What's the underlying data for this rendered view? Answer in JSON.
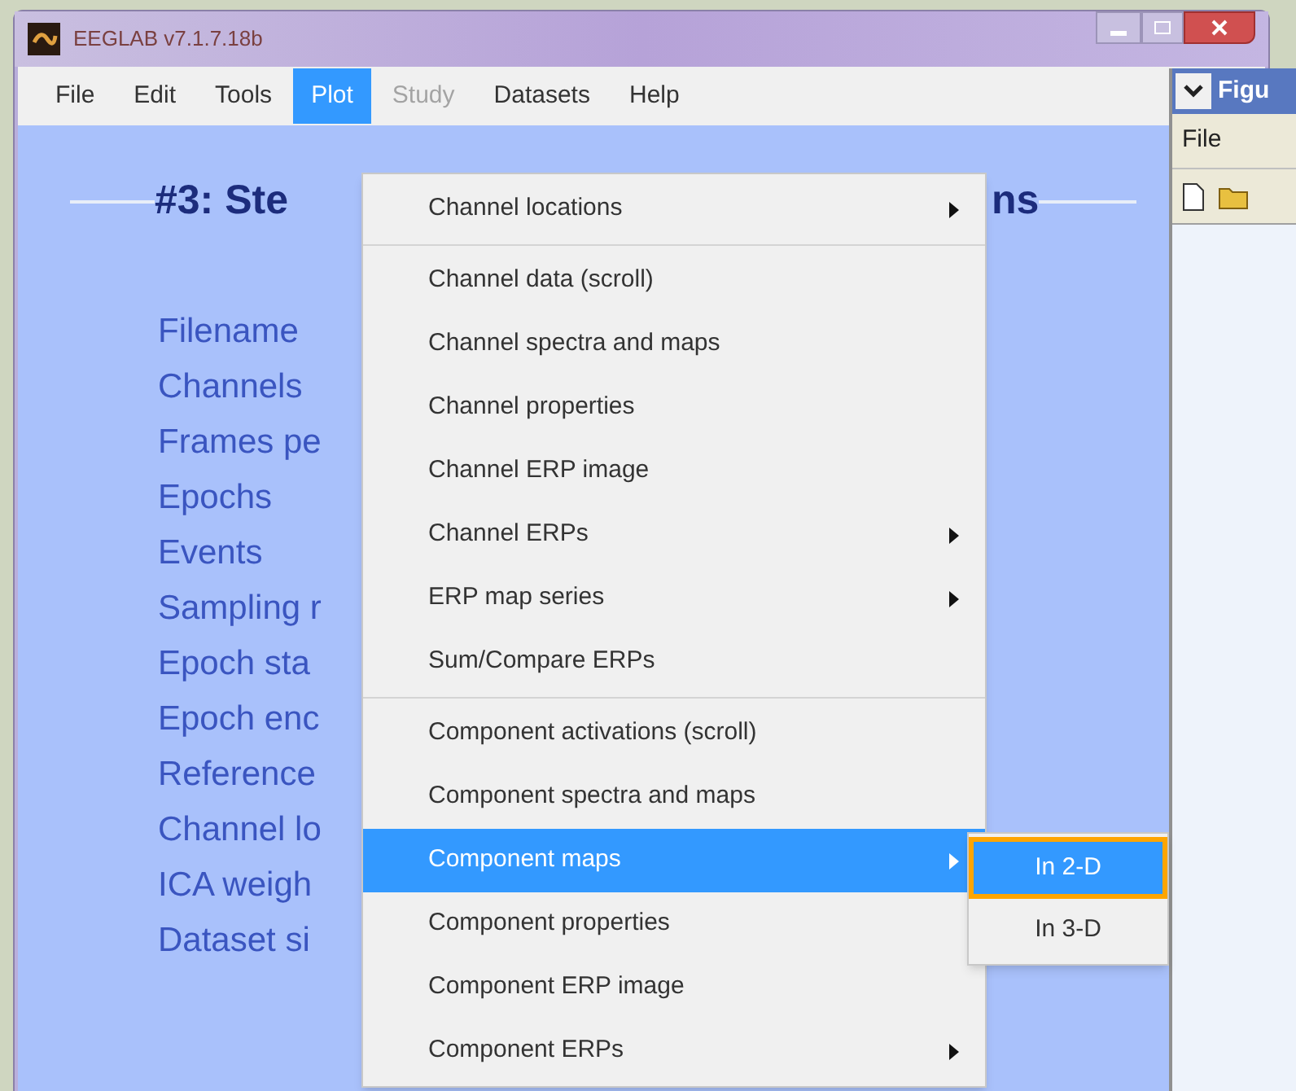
{
  "main_window": {
    "title": "EEGLAB v7.1.7.18b",
    "menu_bar": [
      {
        "label": "File",
        "selected": false,
        "disabled": false
      },
      {
        "label": "Edit",
        "selected": false,
        "disabled": false
      },
      {
        "label": "Tools",
        "selected": false,
        "disabled": false
      },
      {
        "label": "Plot",
        "selected": true,
        "disabled": false
      },
      {
        "label": "Study",
        "selected": false,
        "disabled": true
      },
      {
        "label": "Datasets",
        "selected": false,
        "disabled": false
      },
      {
        "label": "Help",
        "selected": false,
        "disabled": false
      }
    ],
    "heading_left": "#3: Ste",
    "heading_right": "ns",
    "fields": [
      "Filename",
      "Channels",
      "Frames pe",
      "Epochs",
      "Events",
      "Sampling r",
      "Epoch sta",
      "Epoch enc",
      "Reference",
      "Channel lo",
      "ICA weigh",
      "Dataset si"
    ]
  },
  "plot_menu": {
    "groups": [
      [
        {
          "label": "Channel locations",
          "submenu": true,
          "selected": false
        }
      ],
      [
        {
          "label": "Channel data (scroll)",
          "submenu": false,
          "selected": false
        },
        {
          "label": "Channel spectra and maps",
          "submenu": false,
          "selected": false
        },
        {
          "label": "Channel properties",
          "submenu": false,
          "selected": false
        },
        {
          "label": "Channel ERP image",
          "submenu": false,
          "selected": false
        },
        {
          "label": "Channel ERPs",
          "submenu": true,
          "selected": false
        },
        {
          "label": "ERP map series",
          "submenu": true,
          "selected": false
        },
        {
          "label": "Sum/Compare ERPs",
          "submenu": false,
          "selected": false
        }
      ],
      [
        {
          "label": "Component activations (scroll)",
          "submenu": false,
          "selected": false
        },
        {
          "label": "Component spectra and maps",
          "submenu": false,
          "selected": false
        },
        {
          "label": "Component maps",
          "submenu": true,
          "selected": true
        },
        {
          "label": "Component properties",
          "submenu": false,
          "selected": false
        },
        {
          "label": "Component ERP image",
          "submenu": false,
          "selected": false
        },
        {
          "label": "Component ERPs",
          "submenu": true,
          "selected": false
        }
      ]
    ]
  },
  "component_maps_submenu": [
    {
      "label": "In 2-D",
      "selected": true
    },
    {
      "label": "In 3-D",
      "selected": false
    }
  ],
  "figure_window": {
    "title": "Figu",
    "menu_bar": [
      "File"
    ]
  }
}
